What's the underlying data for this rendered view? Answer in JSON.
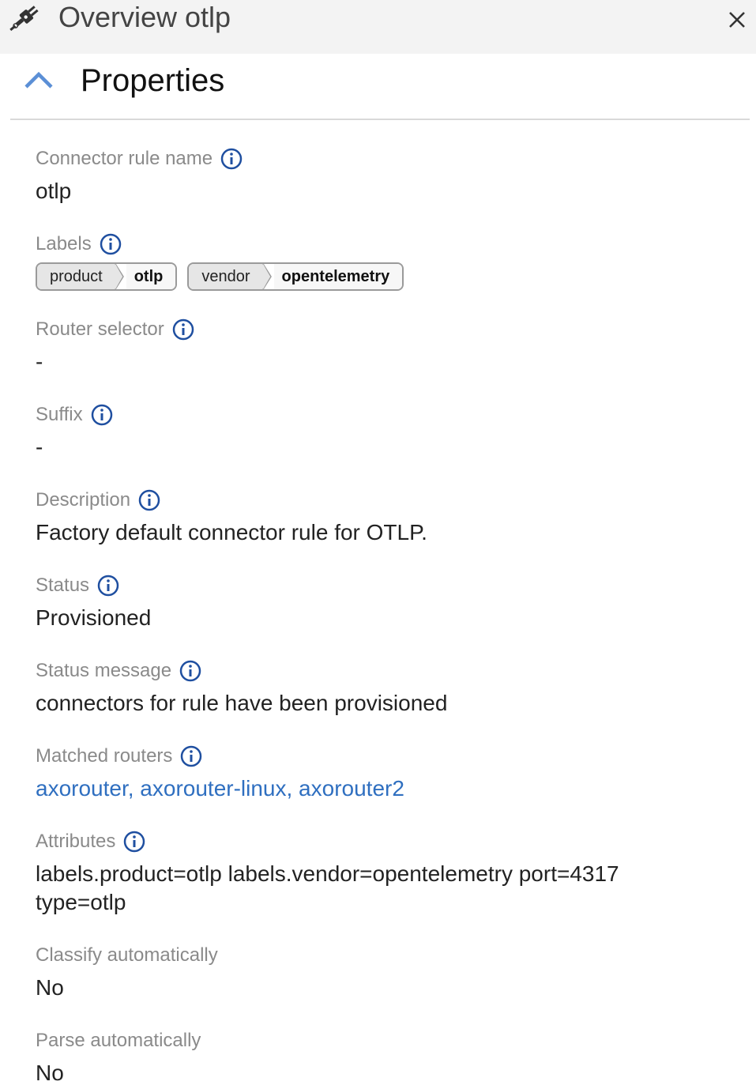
{
  "header": {
    "title": "Overview otlp",
    "icon": "connector-plug-icon",
    "close_icon": "close-icon"
  },
  "section": {
    "title": "Properties",
    "toggle_icon": "chevron-up-icon",
    "accent_color": "#5b8fd6"
  },
  "properties": {
    "connector_rule_name": {
      "label": "Connector rule name",
      "value": "otlp"
    },
    "labels": {
      "label": "Labels",
      "items": [
        {
          "key": "product",
          "value": "otlp"
        },
        {
          "key": "vendor",
          "value": "opentelemetry"
        }
      ]
    },
    "router_selector": {
      "label": "Router selector",
      "value": "-"
    },
    "suffix": {
      "label": "Suffix",
      "value": "-"
    },
    "description": {
      "label": "Description",
      "value": "Factory default connector rule for OTLP."
    },
    "status": {
      "label": "Status",
      "value": "Provisioned"
    },
    "status_message": {
      "label": "Status message",
      "value": "connectors for rule have been provisioned"
    },
    "matched_routers": {
      "label": "Matched routers",
      "value": "axorouter, axorouter-linux, axorouter2",
      "link_color": "#2f6fc0"
    },
    "attributes": {
      "label": "Attributes",
      "line1": "labels.product=otlp labels.vendor=opentelemetry port=4317",
      "line2": "type=otlp"
    },
    "classify_automatically": {
      "label": "Classify automatically",
      "value": "No"
    },
    "parse_automatically": {
      "label": "Parse automatically",
      "value": "No"
    }
  }
}
